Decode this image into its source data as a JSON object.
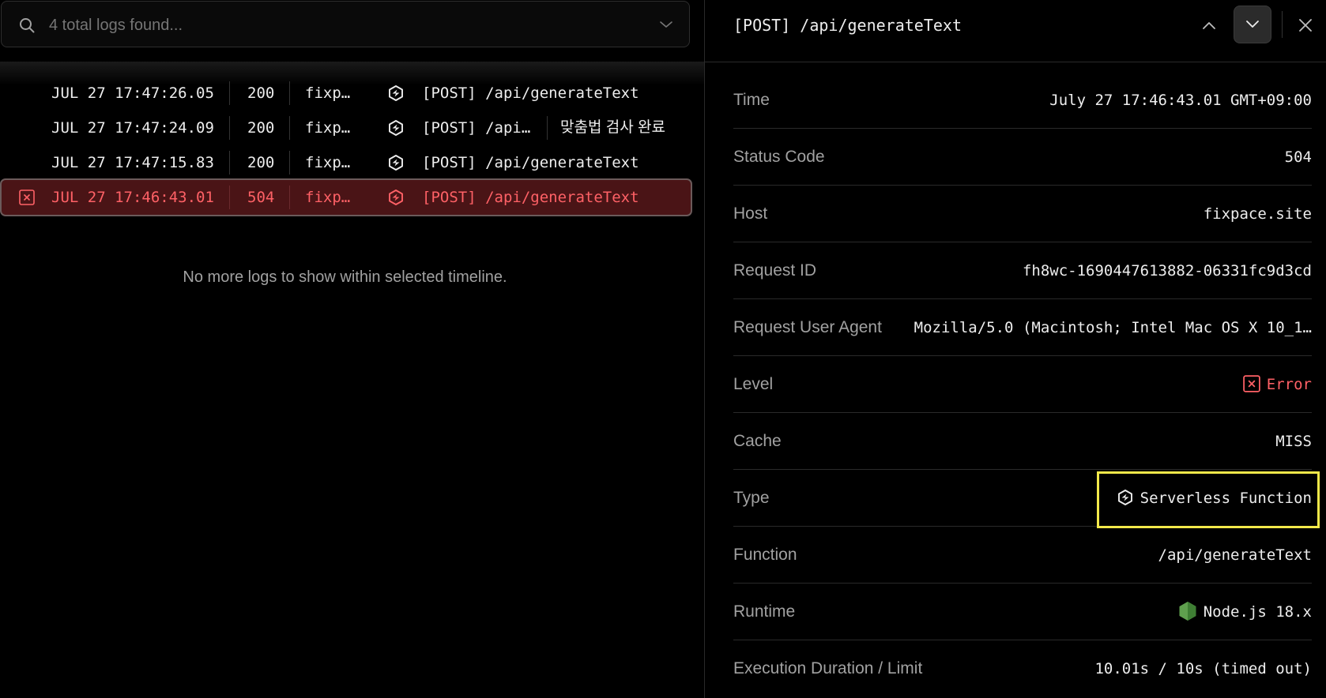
{
  "search": {
    "placeholder": "4 total logs found..."
  },
  "logs": [
    {
      "time": "JUL 27 17:47:26.05",
      "status": "200",
      "host": "fixp…",
      "path": "[POST] /api/generateText",
      "message": "",
      "level": "info",
      "type_icon": "serverless-function-icon"
    },
    {
      "time": "JUL 27 17:47:24.09",
      "status": "200",
      "host": "fixp…",
      "path": "[POST] /api…",
      "message": "맞춤법 검사 완료",
      "level": "info",
      "type_icon": "serverless-function-icon"
    },
    {
      "time": "JUL 27 17:47:15.83",
      "status": "200",
      "host": "fixp…",
      "path": "[POST] /api/generateText",
      "message": "",
      "level": "info",
      "type_icon": "serverless-function-icon"
    },
    {
      "time": "JUL 27 17:46:43.01",
      "status": "504",
      "host": "fixp…",
      "path": "[POST] /api/generateText",
      "message": "",
      "level": "error",
      "type_icon": "serverless-function-icon",
      "selected": true
    }
  ],
  "empty_message": "No more logs to show within selected timeline.",
  "detail": {
    "title": "[POST] /api/generateText",
    "properties": [
      {
        "label": "Time",
        "value": "July 27 17:46:43.01 GMT+09:00"
      },
      {
        "label": "Status Code",
        "value": "504"
      },
      {
        "label": "Host",
        "value": "fixpace.site"
      },
      {
        "label": "Request ID",
        "value": "fh8wc-1690447613882-06331fc9d3cd"
      },
      {
        "label": "Request User Agent",
        "value": "Mozilla/5.0 (Macintosh; Intel Mac OS X 10_1…"
      },
      {
        "label": "Level",
        "value": "Error",
        "icon": "error-x-icon"
      },
      {
        "label": "Cache",
        "value": "MISS"
      },
      {
        "label": "Type",
        "value": "Serverless Function",
        "icon": "serverless-function-icon",
        "highlighted": true
      },
      {
        "label": "Function",
        "value": "/api/generateText"
      },
      {
        "label": "Runtime",
        "value": "Node.js 18.x",
        "icon": "nodejs-icon"
      },
      {
        "label": "Execution Duration / Limit",
        "value": "10.01s / 10s (timed out)"
      }
    ]
  },
  "colors": {
    "error": "#ff6166",
    "error_row_bg": "#4a1416",
    "highlight": "#f2e84a",
    "nodejs": "#5fa04e"
  }
}
